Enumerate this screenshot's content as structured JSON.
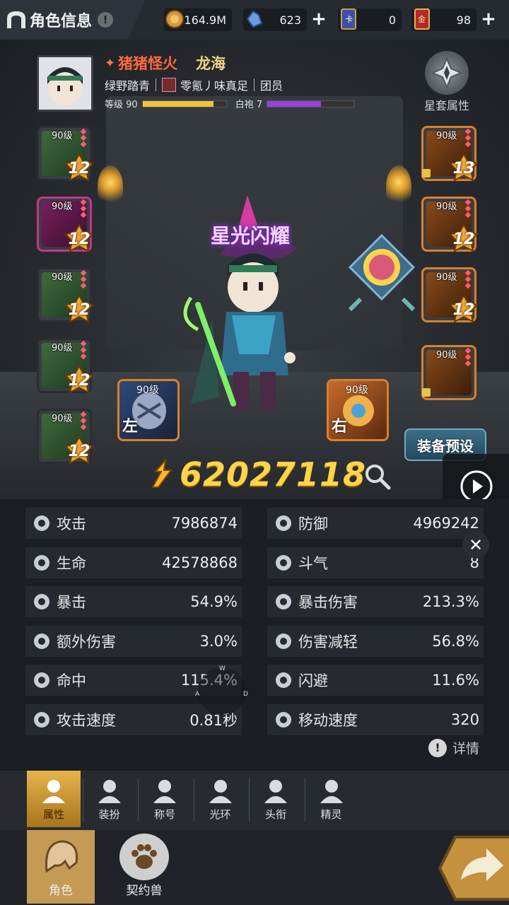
{
  "header": {
    "title": "角色信息",
    "info_glyph": "!",
    "gold": "164.9M",
    "crystal": "623",
    "card": "0",
    "ticket": "98",
    "card_icon_text": "卡",
    "ticket_icon_text": "金"
  },
  "character": {
    "nickname": "猪猪怪火",
    "server": "龙海",
    "title_line": "绿野踏青",
    "guild": "零氪丿味真足",
    "role": "团员",
    "level_label": "等级 90",
    "level_progress": 0.85,
    "rank_label": "白袍 7",
    "rank_progress": 0.62,
    "display_title": "星光闪耀",
    "star_set_label": "星套属性"
  },
  "equipment_left": [
    {
      "level": "90级",
      "enhance": "12",
      "quality": "green"
    },
    {
      "level": "90级",
      "enhance": "12",
      "quality": "magenta"
    },
    {
      "level": "90级",
      "enhance": "12",
      "quality": "green"
    },
    {
      "level": "90级",
      "enhance": "12",
      "quality": "green"
    },
    {
      "level": "90级",
      "enhance": "12",
      "quality": "green"
    }
  ],
  "equipment_right": [
    {
      "level": "90级",
      "enhance": "13",
      "quality": "orange"
    },
    {
      "level": "90级",
      "enhance": "12",
      "quality": "orange"
    },
    {
      "level": "90级",
      "enhance": "12",
      "quality": "orange"
    },
    {
      "level": "90级",
      "enhance": "",
      "quality": "orange"
    }
  ],
  "weapons": {
    "left": {
      "level": "90级",
      "hand": "左"
    },
    "right": {
      "level": "90级",
      "hand": "右"
    }
  },
  "preset_button": "装备预设",
  "power": "62027118",
  "stats": [
    {
      "name": "攻击",
      "value": "7986874"
    },
    {
      "name": "防御",
      "value": "4969242"
    },
    {
      "name": "生命",
      "value": "42578868"
    },
    {
      "name": "斗气",
      "value": "8"
    },
    {
      "name": "暴击",
      "value": "54.9%"
    },
    {
      "name": "暴击伤害",
      "value": "213.3%"
    },
    {
      "name": "额外伤害",
      "value": "3.0%"
    },
    {
      "name": "伤害减轻",
      "value": "56.8%"
    },
    {
      "name": "命中",
      "value": "115.4%"
    },
    {
      "name": "闪避",
      "value": "11.6%"
    },
    {
      "name": "攻击速度",
      "value": "0.81秒"
    },
    {
      "name": "移动速度",
      "value": "320"
    }
  ],
  "detail_label": "详情",
  "close_glyph": "✕",
  "joystick": {
    "w": "W",
    "a": "A",
    "d": "D"
  },
  "tabs": [
    "属性",
    "装扮",
    "称号",
    "光环",
    "头衔",
    "精灵"
  ],
  "bottom_nav": [
    "角色",
    "契约兽"
  ]
}
